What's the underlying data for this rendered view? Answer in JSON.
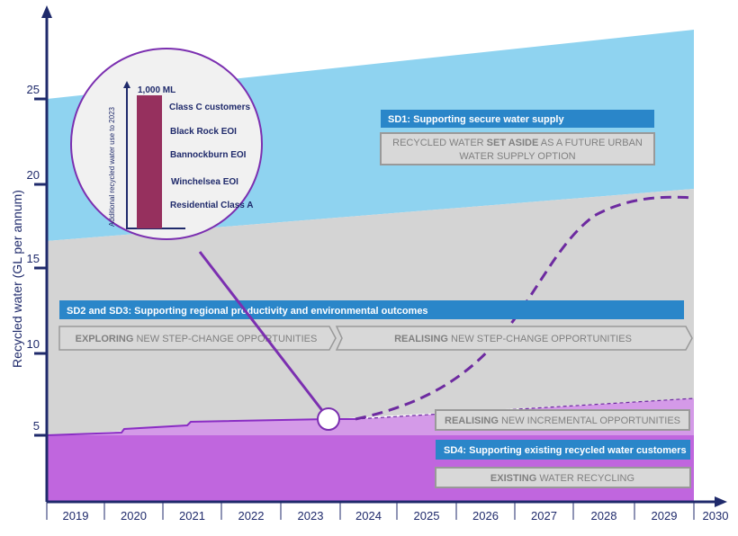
{
  "y_axis": {
    "label": "Recycled water (GL per annum)",
    "ticks": [
      "5",
      "10",
      "15",
      "20",
      "25"
    ]
  },
  "x_axis": {
    "ticks": [
      "2019",
      "2020",
      "2021",
      "2022",
      "2023",
      "2024",
      "2025",
      "2026",
      "2027",
      "2028",
      "2029",
      "2030"
    ]
  },
  "inset": {
    "axis_label": "Additional recycled water use to 2023",
    "bar_label": "1,000 ML",
    "items": [
      "Class C customers",
      "Black Rock EOI",
      "Bannockburn EOI",
      "Winchelsea EOI",
      "Residential Class A"
    ],
    "bar_color": "#96305e"
  },
  "sd1": {
    "title": "SD1: Supporting secure water supply",
    "box_line1_pre": "RECYCLED WATER ",
    "box_line1_bold": "SET ASIDE",
    "box_line1_post": " AS A FUTURE URBAN",
    "box_line2": "WATER SUPPLY OPTION"
  },
  "sd23": {
    "title": "SD2 and SD3:  Supporting regional productivity and environmental outcomes",
    "exploring_bold": "EXPLORING",
    "exploring_rest": " NEW STEP-CHANGE OPPORTUNITIES",
    "realising_bold": "REALISING",
    "realising_rest": " NEW STEP-CHANGE OPPORTUNITIES"
  },
  "incremental": {
    "bold": "REALISING",
    "rest": " NEW INCREMENTAL OPPORTUNITIES"
  },
  "sd4": {
    "title": "SD4: Supporting existing recycled water customers",
    "existing_bold": "EXISTING",
    "existing_rest": " WATER RECYCLING"
  },
  "colors": {
    "blue_area": "#8fd3f0",
    "grey_area": "#d4d4d4",
    "light_purple": "#d49ae8",
    "dark_purple": "#c066de",
    "banner": "#2a86c9",
    "axis": "#1f2a6b",
    "line": "#7b2fb0"
  }
}
